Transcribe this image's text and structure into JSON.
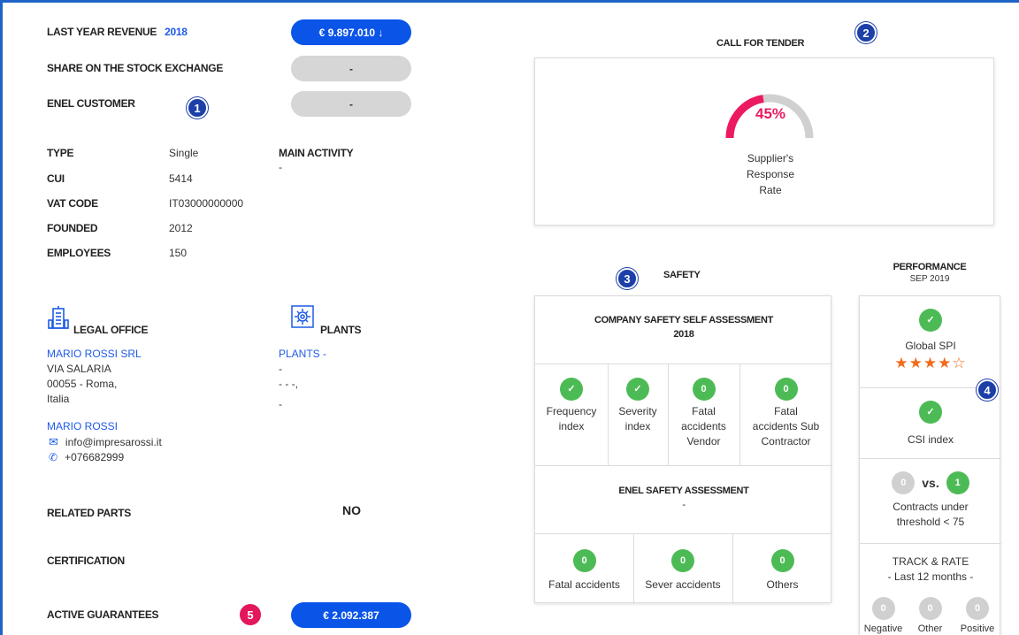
{
  "revenue": {
    "label": "LAST YEAR REVENUE",
    "year": "2018",
    "value": "€ 9.897.010 ↓"
  },
  "stock": {
    "label": "SHARE ON THE STOCK EXCHANGE",
    "value": "-"
  },
  "enel_customer": {
    "label": "ENEL CUSTOMER",
    "value": "-"
  },
  "badges": [
    "1",
    "2",
    "3",
    "4",
    "5"
  ],
  "info": [
    {
      "label": "TYPE",
      "value": "Single"
    },
    {
      "label": "CUI",
      "value": "5414"
    },
    {
      "label": "VAT CODE",
      "value": "IT03000000000"
    },
    {
      "label": "FOUNDED",
      "value": "2012"
    },
    {
      "label": "EMPLOYEES",
      "value": "150"
    }
  ],
  "main_activity": {
    "label": "MAIN ACTIVITY",
    "value": "-"
  },
  "legal_office": {
    "title": "LEGAL OFFICE",
    "company": "MARIO ROSSI SRL",
    "street": "VIA SALARIA",
    "city": "00055 - Roma,",
    "country": "Italia",
    "contact": "MARIO ROSSI",
    "email": "info@impresarossi.it",
    "phone": "+076682999"
  },
  "plants": {
    "title": "PLANTS",
    "link": "PLANTS -",
    "line1": "-",
    "line2": "- - -,",
    "line3": "-"
  },
  "related_parts": {
    "label": "RELATED PARTS",
    "value": "NO"
  },
  "certification": {
    "label": "CERTIFICATION"
  },
  "guarantees": {
    "label": "ACTIVE GUARANTEES",
    "value": "€ 2.092.387"
  },
  "tender": {
    "title": "CALL FOR TENDER",
    "percent": "45%",
    "rate": 0.45,
    "caption_l1": "Supplier's",
    "caption_l2": "Response",
    "caption_l3": "Rate"
  },
  "safety": {
    "title": "SAFETY",
    "self_title": "COMPANY SAFETY SELF ASSESSMENT",
    "self_year": "2018",
    "self_items": [
      {
        "status": "check",
        "l1": "Frequency",
        "l2": "index"
      },
      {
        "status": "check",
        "l1": "Severity",
        "l2": "index"
      },
      {
        "status": "0",
        "l1": "Fatal",
        "l2": "accidents",
        "l3": "Vendor"
      },
      {
        "status": "0",
        "l1": "Fatal",
        "l2": "accidents Sub",
        "l3": "Contractor"
      }
    ],
    "enel_title": "ENEL SAFETY ASSESSMENT",
    "enel_sub": "-",
    "enel_items": [
      {
        "value": "0",
        "label": "Fatal accidents"
      },
      {
        "value": "0",
        "label": "Sever accidents"
      },
      {
        "value": "0",
        "label": "Others"
      }
    ]
  },
  "performance": {
    "title": "PERFORMANCE",
    "date": "SEP 2019",
    "spi_label": "Global SPI",
    "stars": "★★★★☆",
    "star_rating": 4,
    "csi_label": "CSI index",
    "vs_left": "0",
    "vs_text": "vs.",
    "vs_right": "1",
    "contracts_l1": "Contracts under",
    "contracts_l2": "threshold < 75",
    "track_title": "TRACK & RATE",
    "track_sub": "- Last 12 months -",
    "track": [
      {
        "value": "0",
        "label": "Negative"
      },
      {
        "value": "0",
        "label": "Other"
      },
      {
        "value": "0",
        "label": "Positive"
      }
    ]
  }
}
